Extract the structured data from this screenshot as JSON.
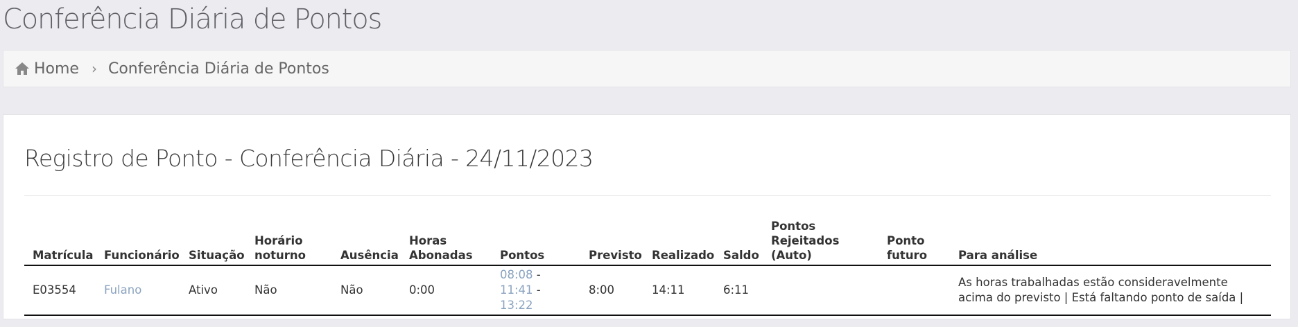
{
  "page": {
    "title": "Conferência Diária de Pontos"
  },
  "breadcrumb": {
    "home_label": "Home",
    "separator": "›",
    "current_label": "Conferência Diária de Pontos"
  },
  "panel": {
    "title": "Registro de Ponto - Conferência Diária - 24/11/2023"
  },
  "table": {
    "headers": {
      "matricula": "Matrícula",
      "funcionario": "Funcionário",
      "situacao": "Situação",
      "horario_noturno_1": "Horário",
      "horario_noturno_2": "noturno",
      "ausencia": "Ausência",
      "horas_abonadas_1": "Horas",
      "horas_abonadas_2": "Abonadas",
      "pontos": "Pontos",
      "previsto": "Previsto",
      "realizado": "Realizado",
      "saldo": "Saldo",
      "pontos_rejeitados_1": "Pontos",
      "pontos_rejeitados_2": "Rejeitados (Auto)",
      "ponto_futuro_1": "Ponto",
      "ponto_futuro_2": "futuro",
      "para_analise": "Para análise"
    },
    "rows": [
      {
        "matricula": "E03554",
        "funcionario": "Fulano",
        "situacao": "Ativo",
        "horario_noturno": "Não",
        "ausencia": "Não",
        "horas_abonadas": "0:00",
        "pontos": [
          "08:08",
          "11:41",
          "13:22"
        ],
        "pontos_separator": " - ",
        "previsto": "8:00",
        "realizado": "14:11",
        "saldo": "6:11",
        "pontos_rejeitados": "",
        "ponto_futuro": "",
        "para_analise": "As horas trabalhadas estão consideravelmente acima do previsto | Está faltando ponto de saída |"
      }
    ]
  },
  "colors": {
    "background": "#ebebf0",
    "link": "#8aa3bf",
    "panel": "#ffffff"
  },
  "icons": {
    "home": "home-icon"
  }
}
